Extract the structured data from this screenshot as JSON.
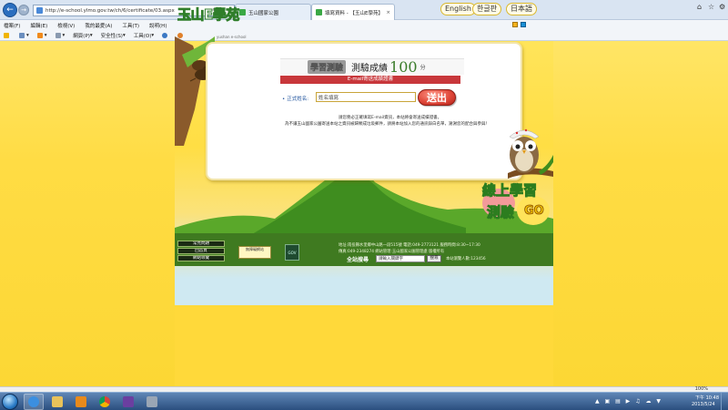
{
  "browser": {
    "address": "http://e-school.ylmo.gov.tw/ch/6/certificate/03.aspx",
    "tabs": [
      {
        "label": "玉山國家公園"
      },
      {
        "label": "填寫資料 - 【玉山E學苑】"
      }
    ],
    "menu": [
      "檔案(F)",
      "編輯(E)",
      "檢視(V)",
      "我的最愛(A)",
      "工具(T)",
      "說明(H)"
    ],
    "commands": [
      "",
      "",
      "",
      "",
      "網頁(P)",
      "安全性(S)",
      "工具(O)",
      "",
      ""
    ]
  },
  "site": {
    "logo_text": "玉山E學苑",
    "logo_sub": "yushan e-school",
    "languages": [
      "English",
      "한글판",
      "日本語"
    ]
  },
  "panel": {
    "title_badge": "學習測驗",
    "title_label": "測驗成績",
    "score": "100",
    "score_unit": "分",
    "email_bar": "E-mail寄送成績證書",
    "name_label": "正式姓名:",
    "name_placeholder": "姓名填寫",
    "submit_label": "送出",
    "note_1": "請您務必正確填寫E-mail資訊，本站將會寄送成績證書。",
    "note_2": "為不讓玉山國家公園寄送本站之資訊被歸類成垃圾郵件，請將本站加入您的通訊錄白名單，謝謝您的配合與參與！"
  },
  "slogan": {
    "line_1": "線上學習",
    "line_2": "測驗",
    "go": "GO"
  },
  "footer": {
    "links": [
      "常見問題",
      "回首頁",
      "網站導覽"
    ],
    "badge_1": "無障礙網站",
    "badge_2": "GOV",
    "info_1": "地址:南投縣水里鄉中山路一段515號 電話:049-2773121 服務時間:8:30~17:30",
    "info_2": "傳真:049-2348274 網站管理:玉山國家公園管理處 版權所有",
    "search_label": "全站搜尋",
    "search_value": "請輸入關鍵字",
    "search_button": "搜尋",
    "counter": "本站瀏覽人數:123456"
  },
  "status": {
    "zoom": "100%"
  },
  "taskbar": {
    "time": "下午 10:48",
    "date": "2013/5/24"
  }
}
